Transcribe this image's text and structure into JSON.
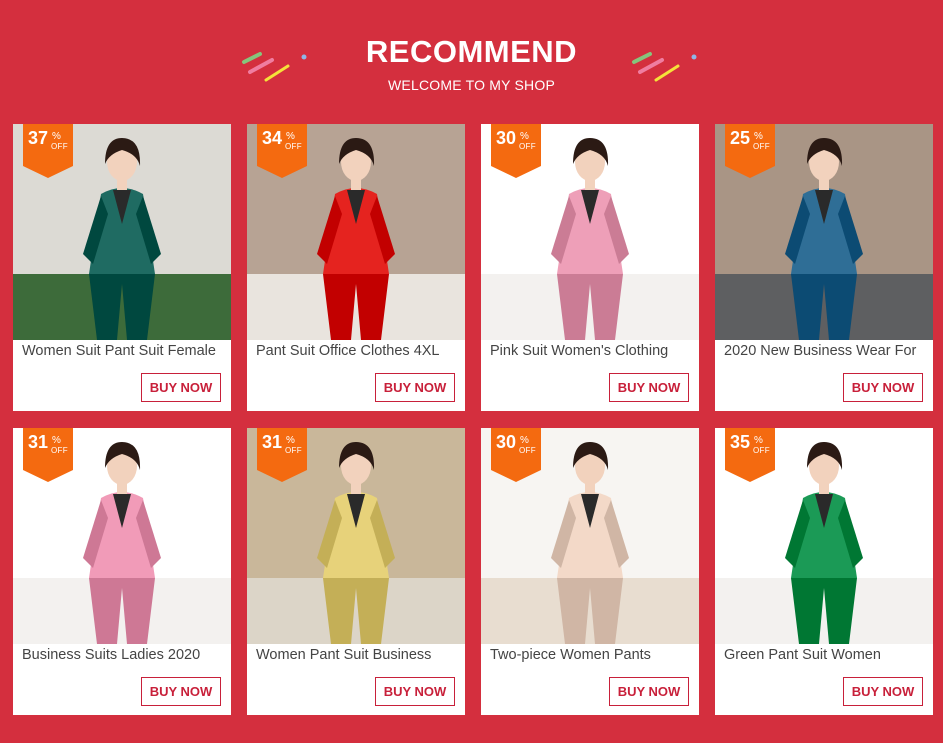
{
  "header": {
    "title": "RECOMMEND",
    "subtitle": "WELCOME TO MY SHOP"
  },
  "colors": {
    "background": "#d42f3e",
    "badge": "#f46a10",
    "buy_border": "#c8203a"
  },
  "products": [
    {
      "discount": "37",
      "pct": "%",
      "off": "OFF",
      "name": "Women Suit Pant Suit Female",
      "buy_label": "BUY NOW",
      "suit_color": "#1f6b62",
      "scene": "garden"
    },
    {
      "discount": "34",
      "pct": "%",
      "off": "OFF",
      "name": "Pant Suit Office Clothes 4XL",
      "buy_label": "BUY NOW",
      "suit_color": "#e5231f",
      "scene": "studio"
    },
    {
      "discount": "30",
      "pct": "%",
      "off": "OFF",
      "name": "Pink Suit Women's Clothing",
      "buy_label": "BUY NOW",
      "suit_color": "#ee9fb8",
      "scene": "white"
    },
    {
      "discount": "25",
      "pct": "%",
      "off": "OFF",
      "name": "2020 New Business Wear For",
      "buy_label": "BUY NOW",
      "suit_color": "#2f6e96",
      "scene": "street"
    },
    {
      "discount": "31",
      "pct": "%",
      "off": "OFF",
      "name": "Business Suits Ladies 2020",
      "buy_label": "BUY NOW",
      "suit_color": "#f19bb8",
      "scene": "white"
    },
    {
      "discount": "31",
      "pct": "%",
      "off": "OFF",
      "name": "Women Pant Suit Business",
      "buy_label": "BUY NOW",
      "suit_color": "#e7d27a",
      "scene": "room"
    },
    {
      "discount": "30",
      "pct": "%",
      "off": "OFF",
      "name": "Two-piece Women Pants",
      "buy_label": "BUY NOW",
      "suit_color": "#f3d9c8",
      "scene": "bright"
    },
    {
      "discount": "35",
      "pct": "%",
      "off": "OFF",
      "name": "Green Pant Suit Women",
      "buy_label": "BUY NOW",
      "suit_color": "#1b9a56",
      "scene": "white"
    }
  ]
}
